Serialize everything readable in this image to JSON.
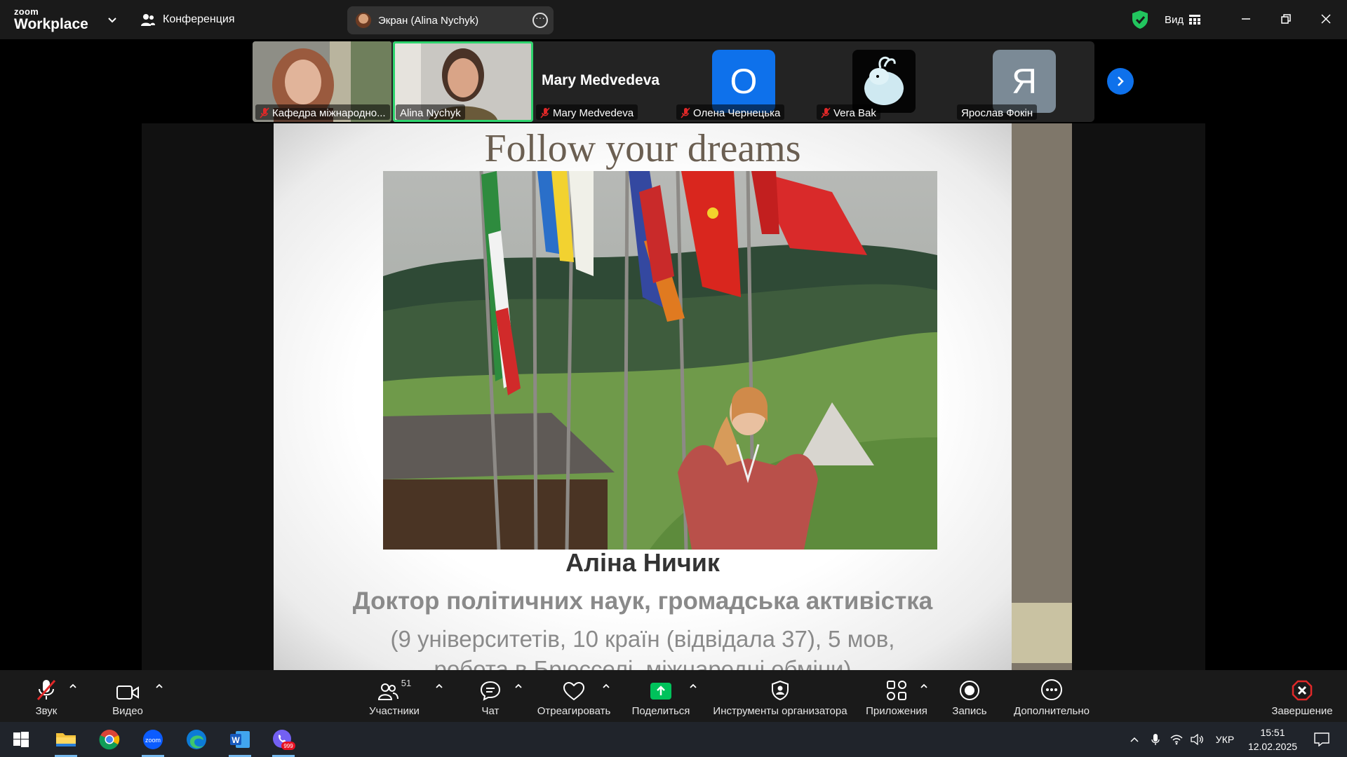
{
  "titlebar": {
    "logo_top": "zoom",
    "logo_bottom": "Workplace",
    "meeting_label": "Конференция",
    "screen_share_label": "Экран (Alina Nychyk)",
    "view_label": "Вид"
  },
  "participants": [
    {
      "name": "Кафедра міжнародно...",
      "muted": true,
      "type": "video"
    },
    {
      "name": "Alina Nychyk",
      "muted": false,
      "type": "video",
      "active": true
    },
    {
      "name": "Mary Medvedeva",
      "muted": true,
      "type": "name",
      "display_name": "Mary Medvedeva"
    },
    {
      "name": "Олена Чернецька",
      "muted": true,
      "type": "letter",
      "letter": "О",
      "color": "#0e71eb"
    },
    {
      "name": "Vera Bak",
      "muted": true,
      "type": "image"
    },
    {
      "name": "Ярослав Фокін",
      "muted": false,
      "type": "letter",
      "letter": "Я",
      "color": "#7b8a96"
    }
  ],
  "slide": {
    "title": "Follow your dreams",
    "name": "Аліна Ничик",
    "subtitle": "Доктор політичних наук, громадська активістка",
    "desc_line1": "(9 університетів, 10 країн (відвідала 37), 5 мов,",
    "desc_line2": "робота в Брюсселі, міжнародні обміни)"
  },
  "toolbar": {
    "audio": "Звук",
    "video": "Видео",
    "participants": "Участники",
    "participants_count": "51",
    "chat": "Чат",
    "react": "Отреагировать",
    "share": "Поделиться",
    "host_tools": "Инструменты организатора",
    "apps": "Приложения",
    "record": "Запись",
    "more": "Дополнительно",
    "end": "Завершение"
  },
  "taskbar": {
    "lang": "УКР",
    "time": "15:51",
    "date": "12.02.2025",
    "viber_badge": "999"
  },
  "colors": {
    "accent_blue": "#0e71eb",
    "active_green": "#2ed36d",
    "end_red": "#e02828",
    "share_green": "#00c25b"
  }
}
